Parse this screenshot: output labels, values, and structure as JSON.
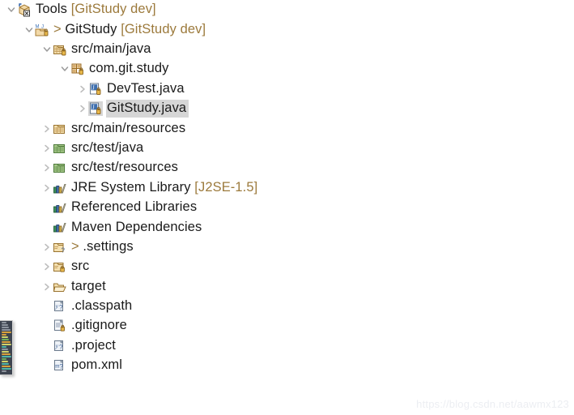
{
  "explorer": {
    "name": "package-explorer-tree",
    "rows": [
      {
        "depth": 0,
        "expander": "expanded",
        "icon": "working-set-icon",
        "text": "Tools ",
        "suffix": "[GitStudy dev]",
        "gt": false,
        "selected": false
      },
      {
        "depth": 1,
        "expander": "expanded",
        "icon": "maven-java-project-icon",
        "text": "GitStudy ",
        "suffix": "[GitStudy dev]",
        "gt": true,
        "selected": false
      },
      {
        "depth": 2,
        "expander": "expanded",
        "icon": "source-folder-icon",
        "text": "src/main/java",
        "suffix": "",
        "gt": false,
        "selected": false
      },
      {
        "depth": 3,
        "expander": "expanded",
        "icon": "package-icon",
        "text": "com.git.study",
        "suffix": "",
        "gt": false,
        "selected": false
      },
      {
        "depth": 4,
        "expander": "collapsed",
        "icon": "java-file-icon",
        "text": "DevTest.java",
        "suffix": "",
        "gt": false,
        "selected": false
      },
      {
        "depth": 4,
        "expander": "collapsed",
        "icon": "java-file-icon",
        "text": "GitStudy.java",
        "suffix": "",
        "gt": false,
        "selected": true
      },
      {
        "depth": 2,
        "expander": "collapsed",
        "icon": "resource-folder-icon",
        "text": "src/main/resources",
        "suffix": "",
        "gt": false,
        "selected": false
      },
      {
        "depth": 2,
        "expander": "collapsed",
        "icon": "test-source-folder-icon",
        "text": "src/test/java",
        "suffix": "",
        "gt": false,
        "selected": false
      },
      {
        "depth": 2,
        "expander": "collapsed",
        "icon": "test-source-folder-icon",
        "text": "src/test/resources",
        "suffix": "",
        "gt": false,
        "selected": false
      },
      {
        "depth": 2,
        "expander": "collapsed",
        "icon": "library-icon",
        "text": "JRE System Library ",
        "suffix": "[J2SE-1.5]",
        "gt": false,
        "selected": false
      },
      {
        "depth": 2,
        "expander": "none",
        "icon": "library-icon",
        "text": "Referenced Libraries",
        "suffix": "",
        "gt": false,
        "selected": false
      },
      {
        "depth": 2,
        "expander": "none",
        "icon": "library-icon",
        "text": "Maven Dependencies",
        "suffix": "",
        "gt": false,
        "selected": false
      },
      {
        "depth": 2,
        "expander": "collapsed",
        "icon": "folder-unversioned-icon",
        "text": ".settings",
        "suffix": "",
        "gt": true,
        "selected": false
      },
      {
        "depth": 2,
        "expander": "collapsed",
        "icon": "folder-tracked-icon",
        "text": "src",
        "suffix": "",
        "gt": false,
        "selected": false
      },
      {
        "depth": 2,
        "expander": "collapsed",
        "icon": "folder-open-icon",
        "text": "target",
        "suffix": "",
        "gt": false,
        "selected": false
      },
      {
        "depth": 2,
        "expander": "none",
        "icon": "xml-file-icon",
        "text": ".classpath",
        "suffix": "",
        "gt": false,
        "selected": false
      },
      {
        "depth": 2,
        "expander": "none",
        "icon": "text-file-icon",
        "text": ".gitignore",
        "suffix": "",
        "gt": false,
        "selected": false
      },
      {
        "depth": 2,
        "expander": "none",
        "icon": "xml-file-icon",
        "text": ".project",
        "suffix": "",
        "gt": false,
        "selected": false
      },
      {
        "depth": 2,
        "expander": "none",
        "icon": "maven-pom-icon",
        "text": "pom.xml",
        "suffix": "",
        "gt": false,
        "selected": false
      }
    ]
  },
  "watermark": {
    "text": "https://blog.csdn.net/aawmx123"
  },
  "minimap": {
    "name": "code-minimap-overlay",
    "colors": [
      "#8d949e",
      "#8d949e",
      "#8d949e",
      "#8d949e",
      "#d8a13a",
      "#d8a13a",
      "#cfd36a",
      "#6fae5a",
      "#d8a13a",
      "#cfd36a",
      "#4fb6a8",
      "#8d949e",
      "#cfd36a",
      "#d8a13a",
      "#4fb6a8",
      "#6fae5a",
      "#cfd36a",
      "#4fb6a8",
      "#d8a13a",
      "#4fb6a8",
      "#8d949e"
    ]
  },
  "colors": {
    "text": "#1a1a1a",
    "dim": "#9c7a3c",
    "selection": "#d6d6d6",
    "arrow": "#9a9a9a",
    "background": "#ffffff"
  }
}
